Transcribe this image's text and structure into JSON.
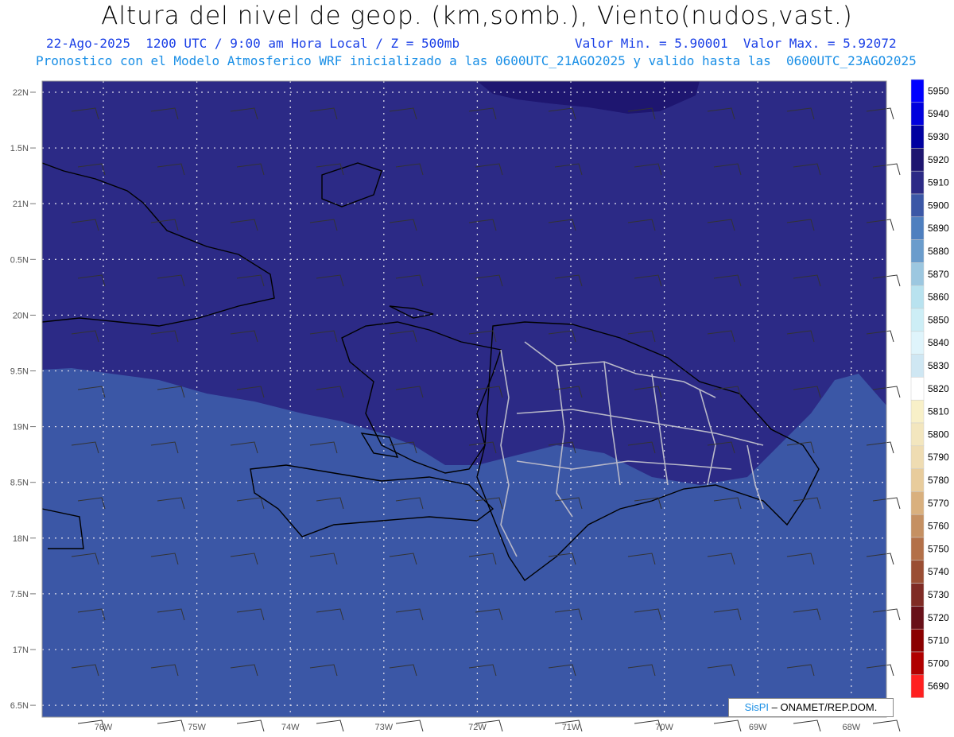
{
  "header": {
    "title": "Altura del nivel de geop. (km,somb.), Viento(nudos,vast.)",
    "line1": "22-Ago-2025  1200 UTC / 9:00 am Hora Local / Z = 500mb",
    "minmax": "Valor Min. = 5.90001  Valor Max. = 5.92072",
    "line2": "Pronostico con el Modelo Atmosferico WRF inicializado a las 0600UTC_21AGO2025 y valido hasta las  0600UTC_23AGO2025"
  },
  "map": {
    "lat_labels": [
      "22N",
      "1.5N",
      "21N",
      "0.5N",
      "20N",
      "9.5N",
      "19N",
      "8.5N",
      "18N",
      "7.5N",
      "17N",
      "6.5N"
    ],
    "lon_labels": [
      "76W",
      "75W",
      "74W",
      "73W",
      "72W",
      "71W",
      "70W",
      "69W",
      "68W"
    ],
    "colors": {
      "dark_band": "#2c2a86",
      "mid_band": "#3b57a6",
      "top_band": "#1e1670",
      "gridline": "#d8d8e8"
    }
  },
  "colorbar": {
    "levels": [
      "5950",
      "5940",
      "5930",
      "5920",
      "5910",
      "5900",
      "5890",
      "5880",
      "5870",
      "5860",
      "5850",
      "5840",
      "5830",
      "5820",
      "5810",
      "5800",
      "5790",
      "5780",
      "5770",
      "5760",
      "5750",
      "5740",
      "5730",
      "5720",
      "5710",
      "5700",
      "5690"
    ],
    "colors": [
      "#0000ff",
      "#0000dd",
      "#0000a0",
      "#1e1670",
      "#2c2a86",
      "#3b57a6",
      "#4e7fbf",
      "#6a9ccc",
      "#9cc7e0",
      "#b8e2ef",
      "#cdeef6",
      "#dff4fb",
      "#cfe7f3",
      "#ffffff",
      "#f8f0c8",
      "#f3e6be",
      "#efdcb2",
      "#e8cc9c",
      "#d9b07e",
      "#c59062",
      "#b37048",
      "#9a4e33",
      "#7f2b24",
      "#681018",
      "#8a0000",
      "#b00000",
      "#ff2020"
    ]
  },
  "credit": {
    "brand": "SisPI",
    "text": " – ONAMET/REP.DOM."
  }
}
